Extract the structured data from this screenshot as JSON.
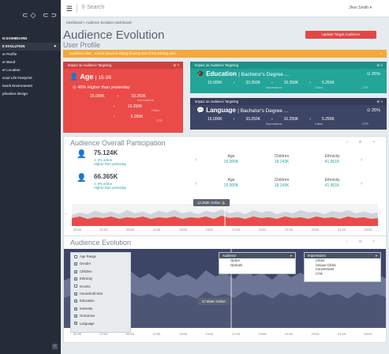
{
  "sidebar": {
    "logo": "⊂◇ ⊂⊃",
    "items": [
      {
        "label": "N DASHBOARD"
      },
      {
        "label": "E EVOLUTION"
      },
      {
        "label": "er Profile"
      },
      {
        "label": "er Mood"
      },
      {
        "label": "er Location"
      },
      {
        "label": "ocial Life Footprint"
      },
      {
        "label": "twork Environment"
      },
      {
        "label": "plication design"
      }
    ],
    "bottom": "»"
  },
  "topbar": {
    "search_placeholder": "Search",
    "user": "Jhon Smith"
  },
  "breadcrumb": {
    "home": "Dashboard",
    "sep": "»",
    "current": "Audience Evolution Dashboard"
  },
  "page": {
    "title": "Audience Evolution",
    "subtitle": "User Profile",
    "update_button": "Update Target Audience"
  },
  "alert": {
    "badge": "Audience Alert",
    "message": "Lorem Ipsum is simply dummy text of the printing and...",
    "close": "×"
  },
  "cards": {
    "age": {
      "header": "Impact on Audience Targeting",
      "title": "Age",
      "subtitle": "| 15-36",
      "pct": "46% Higher than yesterday",
      "from": "15.000K",
      "to": "33.250K",
      "to_cap": "Impressions",
      "clicks": "10.250K",
      "clicks_cap": "Clicks",
      "ctr": "5.250K",
      "ctr_cap": "CTR",
      "controls": "⊘ ×"
    },
    "edu": {
      "header": "Impact on Audience Targeting",
      "title": "Education",
      "subtitle": "| Bachelor's Degree ...",
      "pct": "25%",
      "from": "15.000K",
      "to": "33.250K",
      "to_cap": "Impressions",
      "clicks": "10.250K",
      "clicks_cap": "Clicks",
      "ctr": "5.250K",
      "ctr_cap": "CTR",
      "controls": "⊘ ×"
    },
    "lang": {
      "header": "Impact on Audience Targeting",
      "title": "Language",
      "subtitle": "| Bachelor's Degree ...",
      "pct": "25%",
      "from": "15.000K",
      "to": "33.250K",
      "to_cap": "Impressions",
      "clicks": "10.250K",
      "clicks_cap": "Clicks",
      "ctr": "5.250K",
      "ctr_cap": "CTR",
      "controls": "⊘ ×"
    }
  },
  "participation": {
    "title": "Audience Overall Participation",
    "controls": "○ ⊘ ×",
    "rows": [
      {
        "value": "75.124K",
        "change": "3% online",
        "change2": "Higher than yesterday",
        "segments": [
          {
            "label": "Age",
            "value": "15.000K"
          },
          {
            "label": "Children",
            "value": "18.143K"
          },
          {
            "label": "Ethnicity",
            "value": "41.951K"
          }
        ]
      },
      {
        "value": "66.365K",
        "change": "5% online",
        "change2": "Higher than yesterday",
        "segments": [
          {
            "label": "Age",
            "value": "15.000K"
          },
          {
            "label": "Children",
            "value": "18.143K"
          },
          {
            "label": "Ethnicity",
            "value": "41.951K"
          }
        ]
      }
    ],
    "tooltip": "12.253K Online",
    "times": [
      "00:00",
      "07:00",
      "09:00",
      "11:00",
      "13:00",
      "15:00",
      "17:00",
      "19:00",
      "21:00",
      "23:00",
      "01:00",
      "03:00"
    ]
  },
  "evolution": {
    "title": "Audience Evolution",
    "controls": "○ ⊘ ×",
    "checklist": [
      {
        "label": "Age Range",
        "on": true
      },
      {
        "label": "Gender",
        "on": false
      },
      {
        "label": "Children",
        "on": false
      },
      {
        "label": "Ethnicity",
        "on": false
      },
      {
        "label": "Income",
        "on": true
      },
      {
        "label": "Household Size",
        "on": false
      },
      {
        "label": "Education",
        "on": false
      },
      {
        "label": "Interests",
        "on": false
      },
      {
        "label": "Outcomes",
        "on": false
      },
      {
        "label": "Language",
        "on": false
      }
    ],
    "dropdown1": {
      "header": "Audience",
      "items": [
        "Optics",
        "Opticals"
      ]
    },
    "dropdown2": {
      "header": "Impressions",
      "items": [
        "Clicks",
        "Unique Clicks",
        "Conversions",
        "CTR"
      ]
    },
    "tooltip": "27.053K Online",
    "times": [
      "00:00",
      "07:00",
      "09:00",
      "11:00",
      "13:00",
      "15:00",
      "17:00",
      "19:00",
      "21:00",
      "23:00",
      "01:00",
      "03:00"
    ]
  },
  "colors": {
    "red": "#ea4b48",
    "teal": "#23a599",
    "navy": "#3d4566",
    "orange": "#f2a93a",
    "dark": "#262c37"
  }
}
